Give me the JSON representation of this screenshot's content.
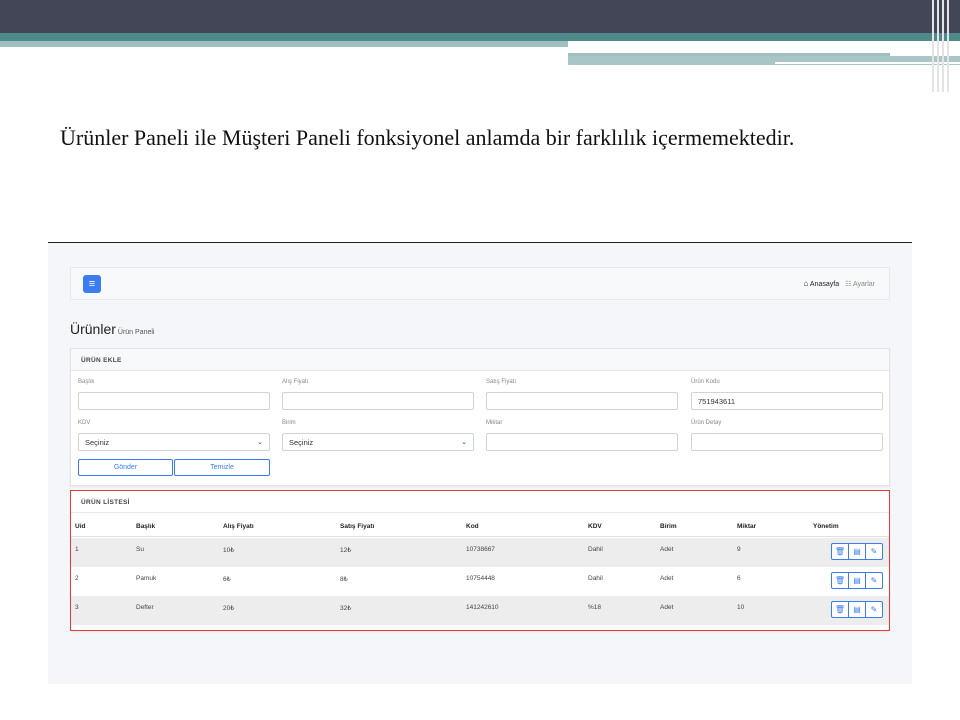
{
  "slide": {
    "text": "Ürünler Paneli ile Müşteri Paneli fonksiyonel anlamda bir farklılık içermemektedir."
  },
  "navbar": {
    "menu_icon": "menu-icon",
    "home_label": "Anasayfa",
    "settings_label": "Ayarlar"
  },
  "page": {
    "title": "Ürünler",
    "subtitle": "Ürün Paneli"
  },
  "form": {
    "header": "ÜRÜN EKLE",
    "fields": [
      {
        "label": "Başlık",
        "value": ""
      },
      {
        "label": "Alış Fiyatı",
        "value": ""
      },
      {
        "label": "Satış Fiyatı",
        "value": ""
      },
      {
        "label": "Ürün Kodu",
        "value": "751943611"
      },
      {
        "label": "KDV",
        "value": "Seçiniz"
      },
      {
        "label": "Birim",
        "value": "Seçiniz"
      },
      {
        "label": "Miktar",
        "value": ""
      },
      {
        "label": "Ürün Detay",
        "value": ""
      }
    ],
    "submit_label": "Gönder",
    "clear_label": "Temizle"
  },
  "list": {
    "header": "ÜRÜN LİSTESİ",
    "columns": [
      "Uid",
      "Başlık",
      "Alış Fiyatı",
      "Satış Fiyatı",
      "Kod",
      "KDV",
      "Birim",
      "Miktar",
      "Yönetim"
    ],
    "rows": [
      [
        "1",
        "Su",
        "10₺",
        "12₺",
        "10738667",
        "Dahil",
        "Adet",
        "9"
      ],
      [
        "2",
        "Pamuk",
        "6₺",
        "8₺",
        "10754448",
        "Dahil",
        "Adet",
        "6"
      ],
      [
        "3",
        "Defter",
        "20₺",
        "32₺",
        "141242610",
        "%18",
        "Adet",
        "10"
      ]
    ]
  },
  "colors": {
    "accent": "#3b7cf1",
    "highlight_border": "#e03a3a",
    "header_dark": "#434656",
    "header_teal": "#4f8a8b"
  }
}
